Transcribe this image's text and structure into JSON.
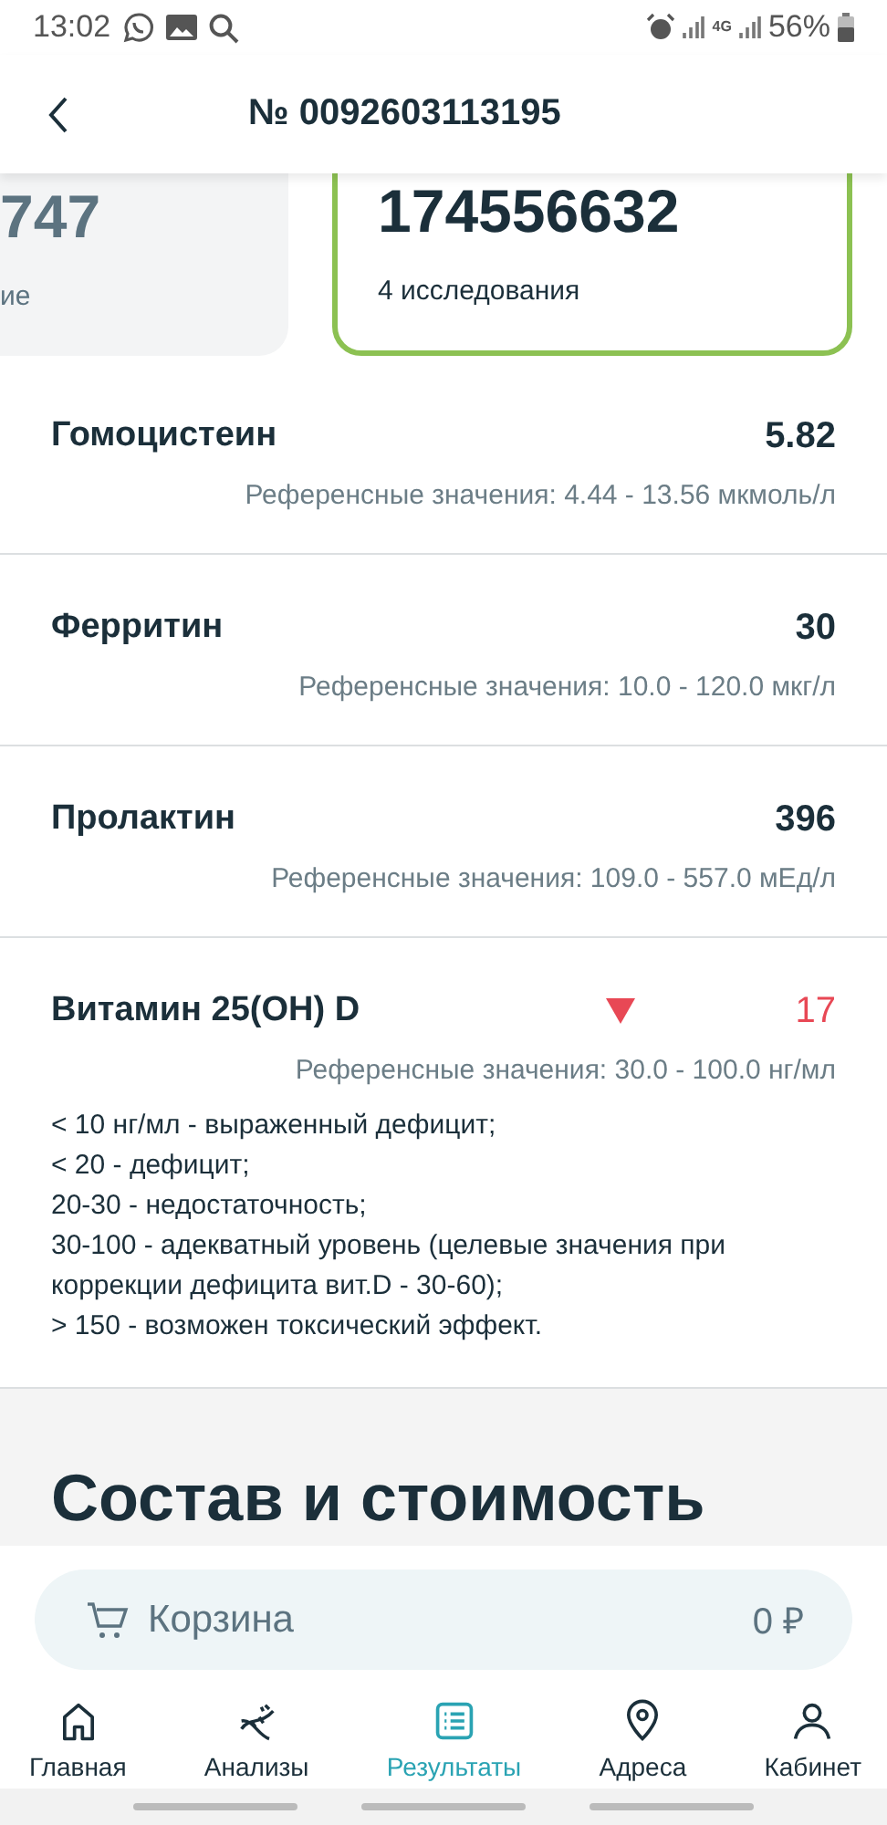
{
  "status_bar": {
    "time": "13:02",
    "network": "4G",
    "battery": "56%"
  },
  "header": {
    "title": "№ 0092603113195"
  },
  "cards": [
    {
      "number": "747",
      "caption": "ие",
      "selected": false
    },
    {
      "number": "174556632",
      "caption": "4 исследования",
      "selected": true
    }
  ],
  "results": [
    {
      "name": "Гомоцистеин",
      "value": "5.82",
      "low": false,
      "reference": "Референсные значения: 4.44 - 13.56 мкмоль/л"
    },
    {
      "name": "Ферритин",
      "value": "30",
      "low": false,
      "reference": "Референсные значения: 10.0 - 120.0 мкг/л"
    },
    {
      "name": "Пролактин",
      "value": "396",
      "low": false,
      "reference": "Референсные значения: 109.0 - 557.0 мЕд/л"
    },
    {
      "name": "Витамин 25(OH) D",
      "value": "17",
      "low": true,
      "reference": "Референсные значения: 30.0 - 100.0 нг/мл",
      "notes": [
        "< 10 нг/мл - выраженный дефицит;",
        "< 20 - дефицит;",
        "20-30 - недостаточность;",
        "30-100 - адекватный уровень (целевые значения при коррекции дефицита вит.D - 30-60);",
        "> 150 - возможен токсический эффект."
      ]
    }
  ],
  "section": {
    "title": "Состав и стоимость"
  },
  "cart": {
    "label": "Корзина",
    "total": "0 ₽"
  },
  "nav": [
    {
      "kind": "home",
      "label": "Главная",
      "selected": false
    },
    {
      "kind": "dna",
      "label": "Анализы",
      "selected": false
    },
    {
      "kind": "list",
      "label": "Результаты",
      "selected": true
    },
    {
      "kind": "pin",
      "label": "Адреса",
      "selected": false
    },
    {
      "kind": "user",
      "label": "Кабинет",
      "selected": false
    }
  ]
}
